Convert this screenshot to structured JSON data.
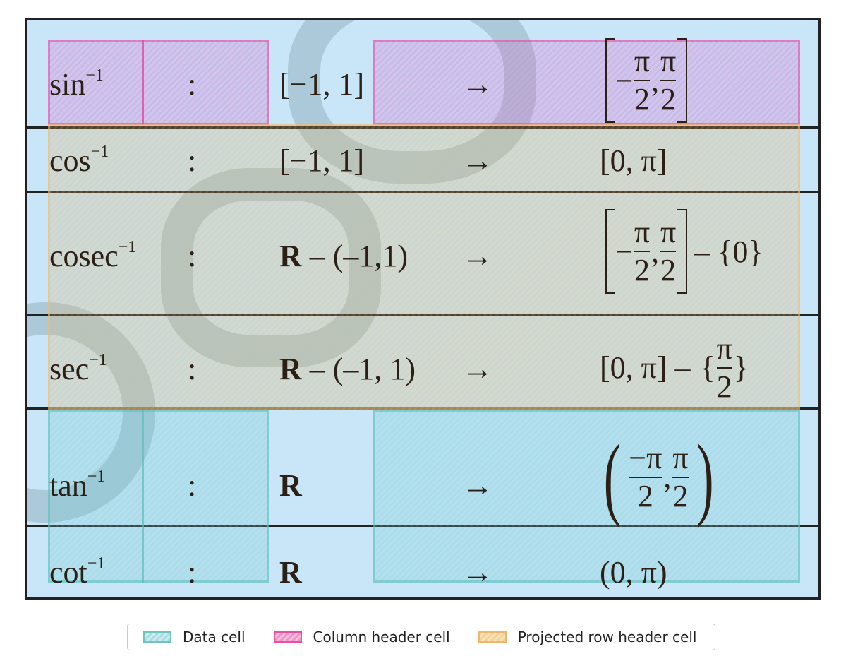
{
  "rows": [
    {
      "func": "sin",
      "exp": "−1",
      "sep": ":",
      "arrow": "→",
      "domain": {
        "bold": "",
        "text": "[−1, 1]"
      },
      "range": {
        "kind": "bracket",
        "sign": "−",
        "num": "π",
        "den": "2",
        "num2": "π",
        "den2": "2",
        "suffix": ""
      }
    },
    {
      "func": "cos",
      "exp": "−1",
      "sep": ":",
      "arrow": "→",
      "domain": {
        "bold": "",
        "text": "[−1, 1]"
      },
      "range": {
        "kind": "text",
        "text": "[0, π]"
      }
    },
    {
      "func": "cosec",
      "exp": "−1",
      "sep": ":",
      "arrow": "→",
      "domain": {
        "bold": "R",
        "text": " – (–1,1)"
      },
      "range": {
        "kind": "bracket",
        "sign": "−",
        "num": "π",
        "den": "2",
        "num2": "π",
        "den2": "2",
        "suffix": "– {0}"
      }
    },
    {
      "func": "sec",
      "exp": "−1",
      "sep": ":",
      "arrow": "→",
      "domain": {
        "bold": "R",
        "text": " – (–1, 1)"
      },
      "range": {
        "kind": "setfrac",
        "prefix": "[0, π] –",
        "num": "π",
        "den": "2"
      }
    },
    {
      "func": "tan",
      "exp": "−1",
      "sep": ":",
      "arrow": "→",
      "domain": {
        "bold": "R",
        "text": ""
      },
      "range": {
        "kind": "paren",
        "num": "−π",
        "den": "2",
        "num2": "π",
        "den2": "2"
      }
    },
    {
      "func": "cot",
      "exp": "−1",
      "sep": ":",
      "arrow": "→",
      "domain": {
        "bold": "R",
        "text": ""
      },
      "range": {
        "kind": "text",
        "text": "(0, π)"
      }
    }
  ],
  "legend": {
    "data_cell": "Data cell",
    "column_header_cell": "Column header cell",
    "projected_row_header_cell": "Projected row header cell"
  },
  "colors": {
    "table_bg": "#c8e6f8",
    "data_cell": "#6ec8cd",
    "column_header_cell": "#e946a0",
    "projected_row_header_cell": "#f0be6e"
  }
}
